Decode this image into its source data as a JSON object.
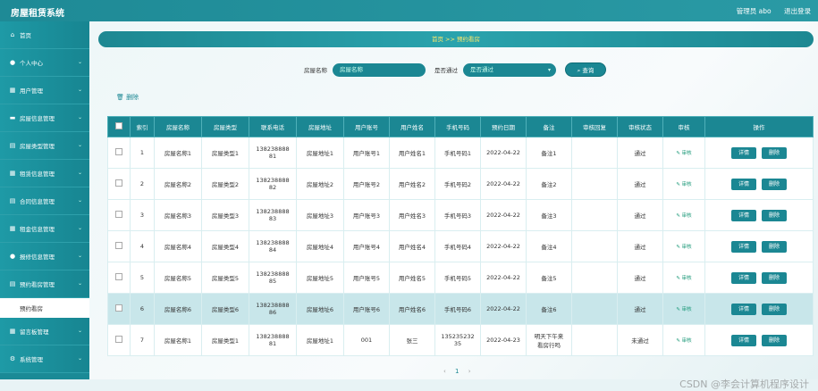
{
  "header": {
    "title": "房屋租赁系统",
    "user": "管理员 abo",
    "logout": "退出登录"
  },
  "sidebar": {
    "items": [
      {
        "label": "首页",
        "icon": "home-icon"
      },
      {
        "label": "个人中心",
        "icon": "user-icon"
      },
      {
        "label": "用户管理",
        "icon": "grid-icon"
      },
      {
        "label": "房屋信息管理",
        "icon": "card-icon"
      },
      {
        "label": "房屋类型管理",
        "icon": "doc-icon"
      },
      {
        "label": "租赁信息管理",
        "icon": "grid-icon"
      },
      {
        "label": "合同信息管理",
        "icon": "doc-icon"
      },
      {
        "label": "租金信息管理",
        "icon": "grid-icon"
      },
      {
        "label": "报修信息管理",
        "icon": "user-icon"
      },
      {
        "label": "预约看房管理",
        "icon": "doc-icon"
      }
    ],
    "sub": "预约看房",
    "items_after": [
      {
        "label": "留言板管理",
        "icon": "grid-icon"
      },
      {
        "label": "系统管理",
        "icon": "gear-icon"
      }
    ]
  },
  "breadcrumb": "首页  >>  预约看房",
  "search": {
    "house_label": "房屋名称",
    "house_placeholder": "房屋名称",
    "passed_label": "是否通过",
    "passed_value": "是否通过",
    "search_button": "查询"
  },
  "toolbar": {
    "delete": "删除"
  },
  "table": {
    "headers": [
      "",
      "索引",
      "房屋名称",
      "房屋类型",
      "联系电话",
      "房屋地址",
      "用户账号",
      "用户姓名",
      "手机号码",
      "预约日期",
      "备注",
      "审核回复",
      "审核状态",
      "审核",
      "操作"
    ],
    "rows": [
      {
        "idx": "1",
        "name": "房屋名称1",
        "type": "房屋类型1",
        "phone": "13823888881",
        "addr": "房屋地址1",
        "account": "用户账号1",
        "uname": "用户姓名1",
        "mobile": "手机号码1",
        "date": "2022-04-22",
        "note": "备注1",
        "reply": "",
        "status": "通过"
      },
      {
        "idx": "2",
        "name": "房屋名称2",
        "type": "房屋类型2",
        "phone": "13823888882",
        "addr": "房屋地址2",
        "account": "用户账号2",
        "uname": "用户姓名2",
        "mobile": "手机号码2",
        "date": "2022-04-22",
        "note": "备注2",
        "reply": "",
        "status": "通过"
      },
      {
        "idx": "3",
        "name": "房屋名称3",
        "type": "房屋类型3",
        "phone": "13823888883",
        "addr": "房屋地址3",
        "account": "用户账号3",
        "uname": "用户姓名3",
        "mobile": "手机号码3",
        "date": "2022-04-22",
        "note": "备注3",
        "reply": "",
        "status": "通过"
      },
      {
        "idx": "4",
        "name": "房屋名称4",
        "type": "房屋类型4",
        "phone": "13823888884",
        "addr": "房屋地址4",
        "account": "用户账号4",
        "uname": "用户姓名4",
        "mobile": "手机号码4",
        "date": "2022-04-22",
        "note": "备注4",
        "reply": "",
        "status": "通过"
      },
      {
        "idx": "5",
        "name": "房屋名称5",
        "type": "房屋类型5",
        "phone": "13823888885",
        "addr": "房屋地址5",
        "account": "用户账号5",
        "uname": "用户姓名5",
        "mobile": "手机号码5",
        "date": "2022-04-22",
        "note": "备注5",
        "reply": "",
        "status": "通过"
      },
      {
        "idx": "6",
        "name": "房屋名称6",
        "type": "房屋类型6",
        "phone": "13823888886",
        "addr": "房屋地址6",
        "account": "用户账号6",
        "uname": "用户姓名6",
        "mobile": "手机号码6",
        "date": "2022-04-22",
        "note": "备注6",
        "reply": "",
        "status": "通过"
      },
      {
        "idx": "7",
        "name": "房屋名称1",
        "type": "房屋类型1",
        "phone": "13823888881",
        "addr": "房屋地址1",
        "account": "001",
        "uname": "张三",
        "mobile": "13523523235",
        "date": "2022-04-23",
        "note": "明天下午来看房行吗",
        "reply": "",
        "status": "未通过"
      }
    ],
    "audit_label": "审核",
    "detail_label": "详情",
    "delete_label": "删除"
  },
  "pager": {
    "prev": "‹",
    "current": "1",
    "next": "›"
  },
  "watermark": "CSDN @李会计算机程序设计",
  "colors": {
    "primary": "#1b8793",
    "accent": "#ffe86a"
  }
}
